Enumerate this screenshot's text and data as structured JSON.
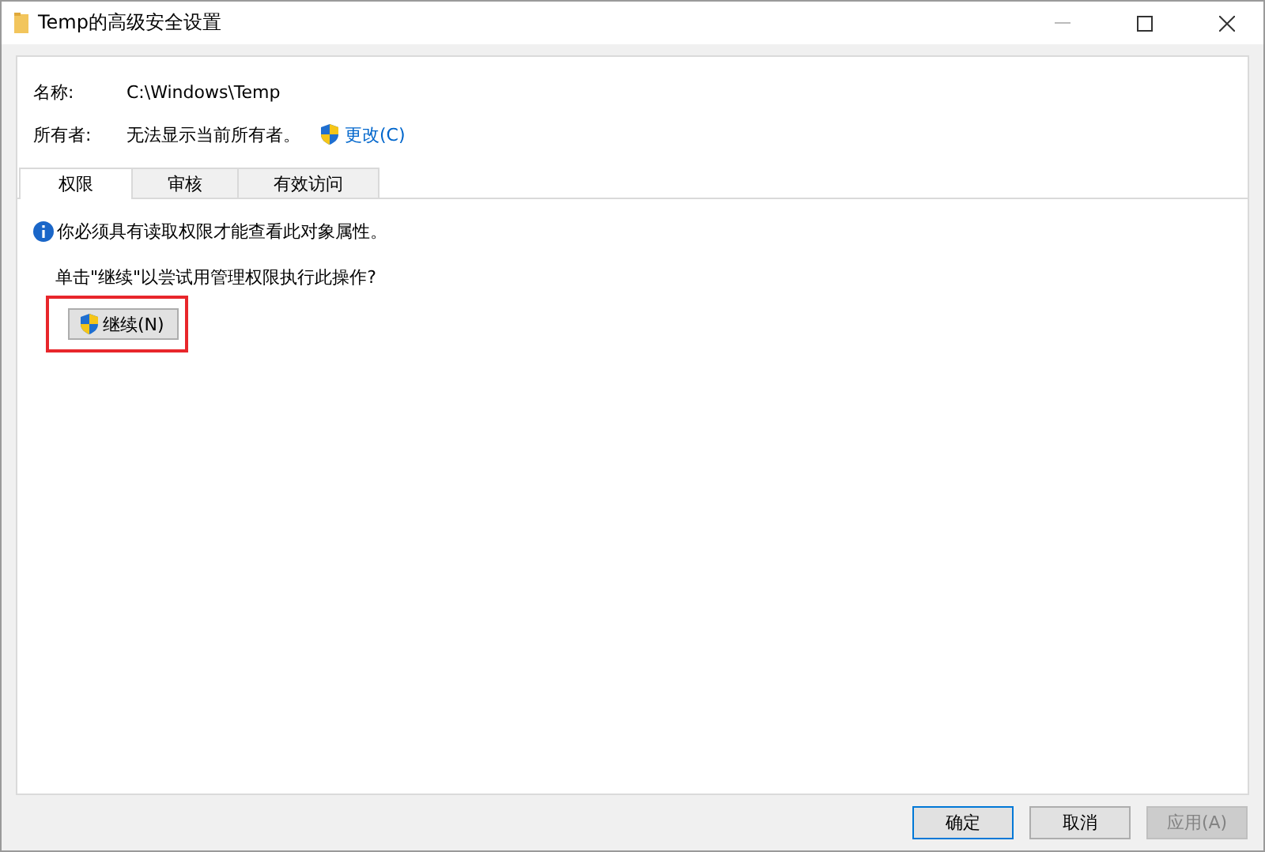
{
  "window": {
    "title": "Temp的高级安全设置"
  },
  "fields": [
    {
      "label": "名称:",
      "value": "C:\\Windows\\Temp"
    },
    {
      "label": "所有者:",
      "value": "无法显示当前所有者。",
      "link": "更改(C)"
    }
  ],
  "tabs": [
    {
      "label": "权限",
      "selected": true
    },
    {
      "label": "审核",
      "selected": false
    },
    {
      "label": "有效访问",
      "selected": false
    }
  ],
  "info": "你必须具有读取权限才能查看此对象属性。",
  "prompt": "单击\"继续\"以尝试用管理权限执行此操作?",
  "continue_button": {
    "label": "继续(N)",
    "highlighted": true
  },
  "buttons": [
    {
      "label": "确定",
      "default": true,
      "disabled": false
    },
    {
      "label": "取消",
      "default": false,
      "disabled": false
    },
    {
      "label": "应用(A)",
      "default": false,
      "disabled": true
    }
  ]
}
